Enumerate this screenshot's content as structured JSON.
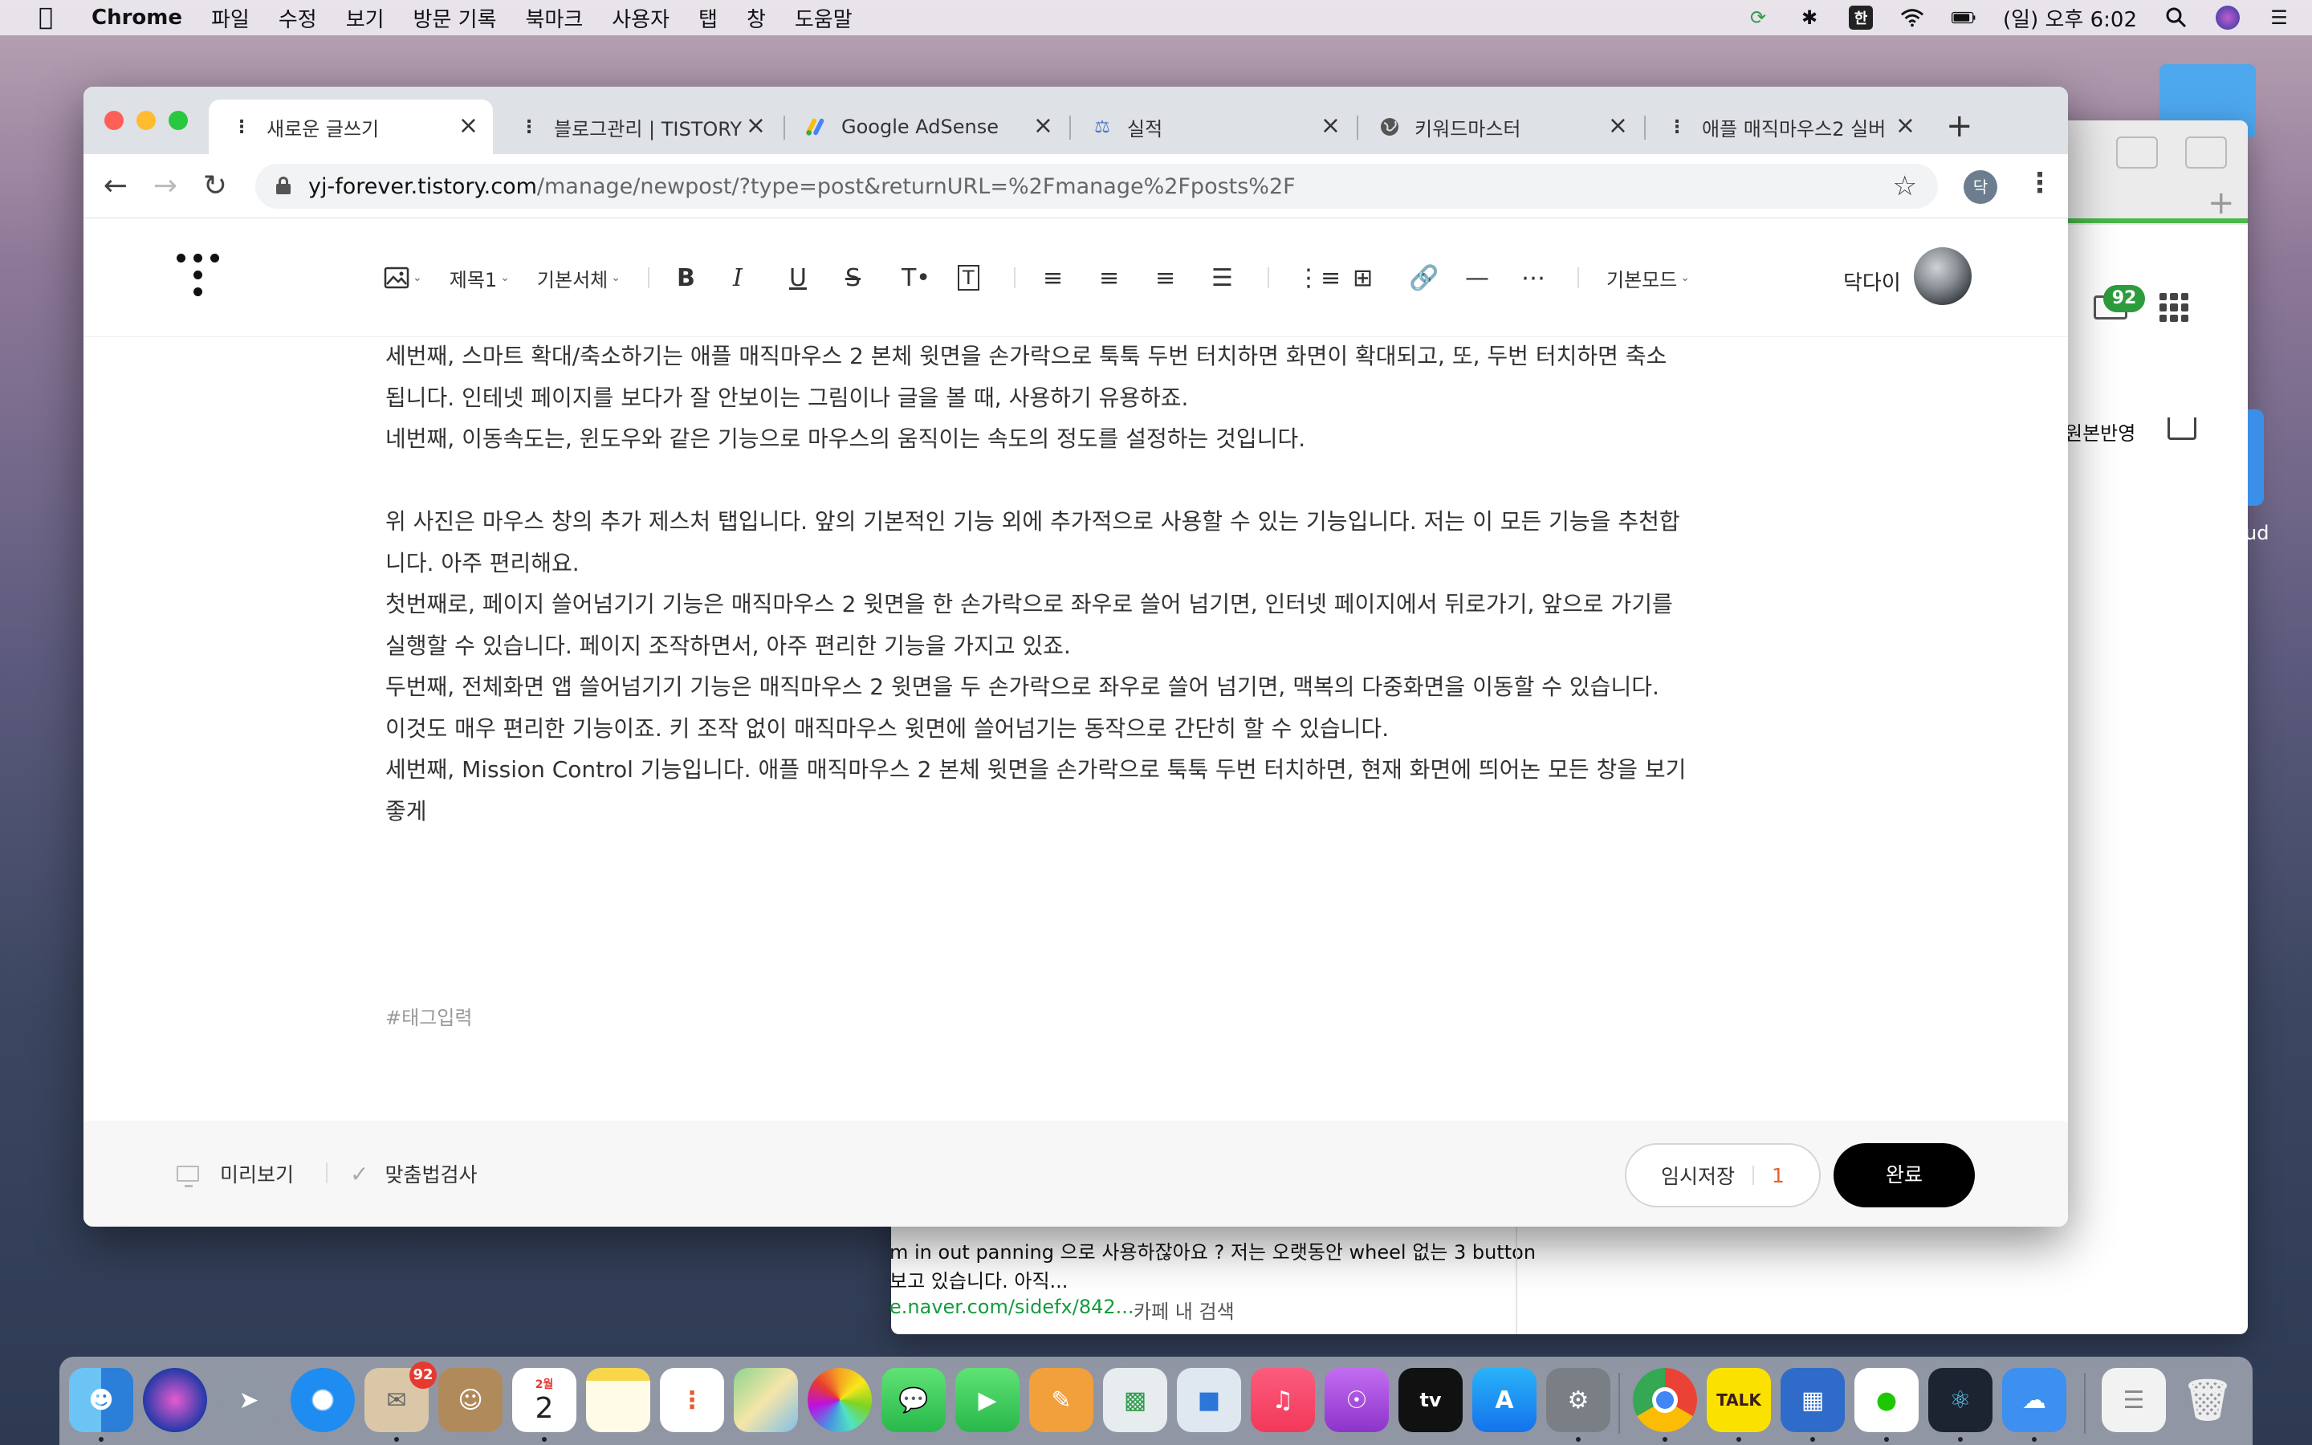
{
  "menubar": {
    "app": "Chrome",
    "items": [
      "파일",
      "수정",
      "보기",
      "방문 기록",
      "북마크",
      "사용자",
      "탭",
      "창",
      "도움말"
    ],
    "input_method": "한",
    "clock": "(일) 오후 6:02"
  },
  "background_app": {
    "snippet_line1": "m in out panning 으로 사용하잖아요 ? 저는 오랫동안 wheel 없는 3 button",
    "snippet_line2": "보고 있습니다. 아직...",
    "snippet_url": "e.naver.com/sidefx/842...",
    "snippet_search": "카페 내 검색",
    "mail_count": "92",
    "original_reflect": "원본반영",
    "icloud_partial": "ud"
  },
  "browser": {
    "tabs": [
      {
        "label": "새로운 글쓰기",
        "favicon": "tistory-icon",
        "active": true
      },
      {
        "label": "블로그관리 | TISTORY",
        "favicon": "tistory-icon",
        "active": false
      },
      {
        "label": "Google AdSense",
        "favicon": "adsense-icon",
        "active": false
      },
      {
        "label": "실적",
        "favicon": "analytics-icon",
        "active": false
      },
      {
        "label": "키워드마스터",
        "favicon": "globe-icon",
        "active": false
      },
      {
        "label": "애플 매직마우스2 실버",
        "favicon": "tistory-icon",
        "active": false
      }
    ],
    "url_host": "yj-forever.tistory.com",
    "url_path": "/manage/newpost/?type=post&returnURL=%2Fmanage%2Fposts%2F",
    "profile_initial": "닥"
  },
  "editor": {
    "toolbar": {
      "heading": "제목1",
      "font": "기본서체",
      "mode": "기본모드"
    },
    "user_name": "닥다이",
    "paragraphs": [
      "세번째, 스마트 확대/축소하기는 애플 매직마우스 2  본체 윗면을 손가락으로 툭툭 두번 터치하면 화면이 확대되고, 또, 두번 터치하면 축소",
      "됩니다. 인테넷 페이지를 보다가 잘 안보이는 그림이나 글을 볼 때, 사용하기 유용하죠.",
      "네번째, 이동속도는, 윈도우와 같은 기능으로 마우스의 움직이는 속도의 정도를 설정하는 것입니다.",
      "",
      "위 사진은 마우스 창의 추가 제스처 탭입니다. 앞의 기본적인 기능 외에 추가적으로 사용할 수 있는 기능입니다. 저는 이 모든 기능을 추천합",
      "니다. 아주 편리해요.",
      "첫번째로, 페이지 쓸어넘기기 기능은 매직마우스 2 윗면을 한 손가락으로 좌우로 쓸어 넘기면, 인터넷 페이지에서 뒤로가기, 앞으로 가기를",
      "실행할 수 있습니다. 페이지 조작하면서, 아주 편리한 기능을 가지고 있죠.",
      "두번째, 전체화면 앱 쓸어넘기기 기능은 매직마우스 2 윗면을 두 손가락으로 좌우로 쓸어 넘기면, 맥복의 다중화면을 이동할 수 있습니다.",
      "이것도 매우 편리한 기능이죠. 키 조작 없이 매직마우스 윗면에 쓸어넘기는 동작으로 간단히 할 수 있습니다.",
      "세번째, Mission Control 기능입니다. 애플 매직마우스 2  본체 윗면을 손가락으로 툭툭 두번 터치하면, 현재 화면에 띄어논 모든 창을 보기",
      "좋게"
    ],
    "tag_placeholder": "#태그입력",
    "bottom": {
      "preview": "미리보기",
      "spellcheck": "맞춤법검사",
      "draft_save": "임시저장",
      "draft_count": "1",
      "done": "완료"
    }
  },
  "dock": {
    "mail_badge": "92",
    "calendar_month": "2월",
    "calendar_day": "2",
    "kakao_label": "TALK",
    "tv_label": "tv"
  },
  "colors": {
    "accent_orange": "#e8602c",
    "done_button": "#000000",
    "naver_green": "#2d9c3c"
  }
}
